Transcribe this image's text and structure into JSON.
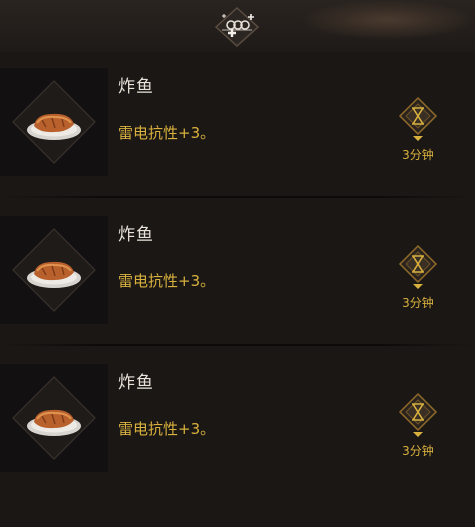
{
  "header": {
    "emblem_icon": "buff-sparkle-icon"
  },
  "colors": {
    "accent_gold": "#d8b13e",
    "text_light": "#e8e2da",
    "background": "#1b1715"
  },
  "food_buffs": [
    {
      "name": "炸鱼",
      "effect": "雷电抗性+3。",
      "duration": "3分钟",
      "icon": "fried-fish-icon"
    },
    {
      "name": "炸鱼",
      "effect": "雷电抗性+3。",
      "duration": "3分钟",
      "icon": "fried-fish-icon"
    },
    {
      "name": "炸鱼",
      "effect": "雷电抗性+3。",
      "duration": "3分钟",
      "icon": "fried-fish-icon"
    }
  ]
}
